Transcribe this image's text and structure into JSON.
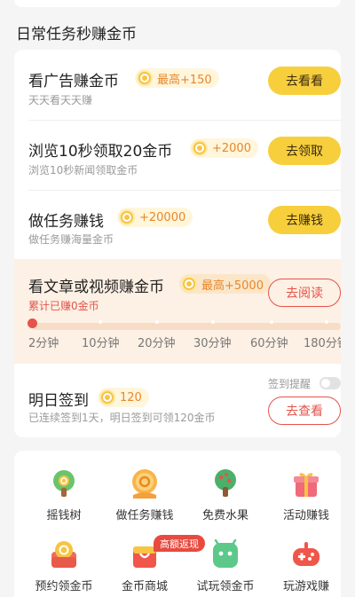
{
  "section_title": "日常任务秒赚金币",
  "tasks": [
    {
      "title": "看广告赚金币",
      "reward": "最高+150",
      "sub": "天天看天天赚",
      "button": "去看看"
    },
    {
      "title": "浏览10秒领取20金币",
      "reward": "+2000",
      "sub": "浏览10秒新闻领取金币",
      "button": "去领取"
    },
    {
      "title": "做任务赚钱",
      "reward": "+20000",
      "sub": "做任务赚海量金币",
      "button": "去赚钱"
    }
  ],
  "article": {
    "title": "看文章或视频赚金币",
    "reward": "最高+5000",
    "sub": "累计已赚0金币",
    "button": "去阅读",
    "progress": 0,
    "ticks": [
      "2分钟",
      "10分钟",
      "20分钟",
      "30分钟",
      "60分钟",
      "180分钟"
    ]
  },
  "checkin": {
    "title": "明日签到",
    "reward": "120",
    "sub": "已连续签到1天，明日签到可领120金币",
    "reminder_label": "签到提醒",
    "reminder_on": false,
    "button": "去查看"
  },
  "grid": {
    "badge": "高额返现",
    "items": [
      {
        "label": "摇钱树",
        "icon": "money-tree-icon"
      },
      {
        "label": "做任务赚钱",
        "icon": "task-coin-icon"
      },
      {
        "label": "免费水果",
        "icon": "fruit-tree-icon"
      },
      {
        "label": "活动赚钱",
        "icon": "gift-box-icon"
      },
      {
        "label": "预约领金币",
        "icon": "reserve-coin-icon"
      },
      {
        "label": "金币商城",
        "icon": "coin-mall-icon"
      },
      {
        "label": "试玩领金币",
        "icon": "android-icon"
      },
      {
        "label": "玩游戏赚",
        "icon": "gamepad-icon"
      }
    ]
  },
  "colors": {
    "accent_yellow": "#f7cf3c",
    "accent_red": "#e5534b",
    "reward_orange": "#e8872b",
    "highlight_bg": "#fdf0e4"
  }
}
